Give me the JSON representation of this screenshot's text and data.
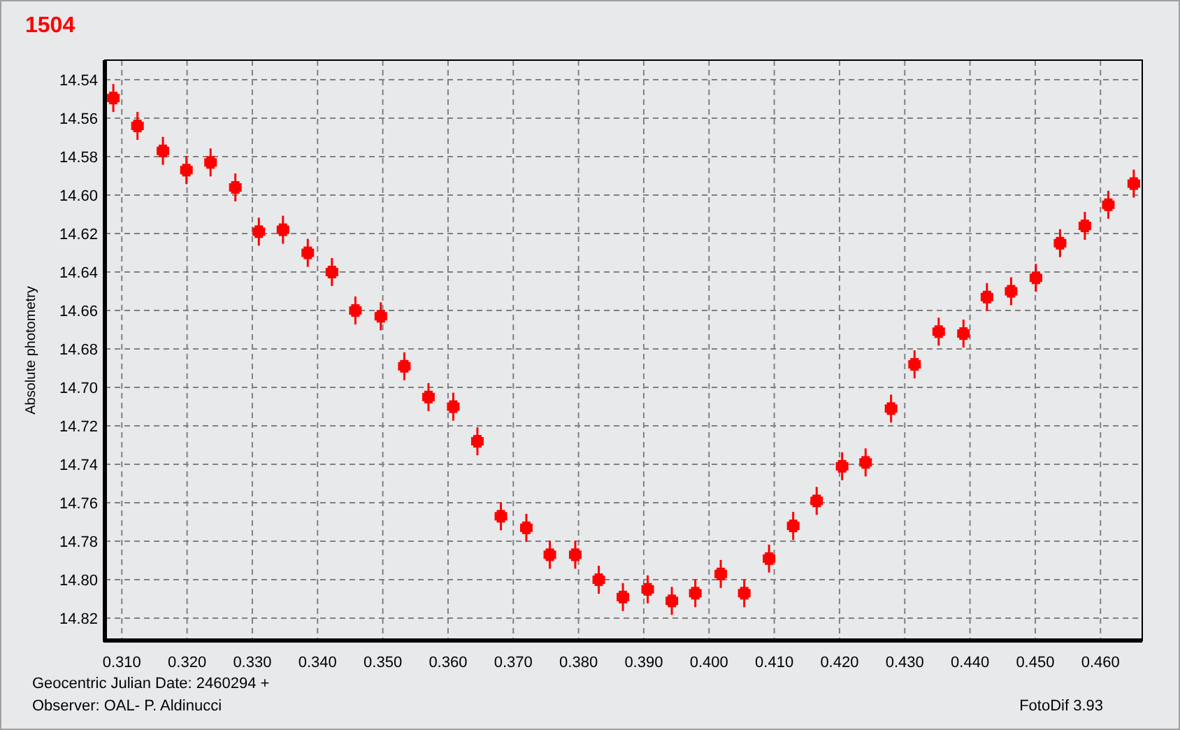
{
  "chart_data": {
    "type": "scatter",
    "grid": true,
    "ylabel": "Absolute photometry",
    "xlim": [
      0.3074,
      0.4664
    ],
    "ylim": [
      14.8316,
      14.5298
    ],
    "xticks": [
      {
        "value": 0.31,
        "label": "0.310"
      },
      {
        "value": 0.32,
        "label": "0.320"
      },
      {
        "value": 0.33,
        "label": "0.330"
      },
      {
        "value": 0.34,
        "label": "0.340"
      },
      {
        "value": 0.35,
        "label": "0.350"
      },
      {
        "value": 0.36,
        "label": "0.360"
      },
      {
        "value": 0.37,
        "label": "0.370"
      },
      {
        "value": 0.38,
        "label": "0.380"
      },
      {
        "value": 0.39,
        "label": "0.390"
      },
      {
        "value": 0.4,
        "label": "0.400"
      },
      {
        "value": 0.41,
        "label": "0.410"
      },
      {
        "value": 0.42,
        "label": "0.420"
      },
      {
        "value": 0.43,
        "label": "0.430"
      },
      {
        "value": 0.44,
        "label": "0.440"
      },
      {
        "value": 0.45,
        "label": "0.450"
      },
      {
        "value": 0.46,
        "label": "0.460"
      }
    ],
    "yticks": [
      {
        "value": 14.54,
        "label": "14.54"
      },
      {
        "value": 14.56,
        "label": "14.56"
      },
      {
        "value": 14.58,
        "label": "14.58"
      },
      {
        "value": 14.6,
        "label": "14.60"
      },
      {
        "value": 14.62,
        "label": "14.62"
      },
      {
        "value": 14.64,
        "label": "14.64"
      },
      {
        "value": 14.66,
        "label": "14.66"
      },
      {
        "value": 14.68,
        "label": "14.68"
      },
      {
        "value": 14.7,
        "label": "14.70"
      },
      {
        "value": 14.72,
        "label": "14.72"
      },
      {
        "value": 14.74,
        "label": "14.74"
      },
      {
        "value": 14.76,
        "label": "14.76"
      },
      {
        "value": 14.78,
        "label": "14.78"
      },
      {
        "value": 14.8,
        "label": "14.80"
      },
      {
        "value": 14.82,
        "label": "14.82"
      }
    ],
    "x": [
      0.3087,
      0.3124,
      0.3163,
      0.3199,
      0.3236,
      0.3274,
      0.331,
      0.3347,
      0.3385,
      0.3422,
      0.3458,
      0.3497,
      0.3533,
      0.357,
      0.3608,
      0.3645,
      0.3681,
      0.372,
      0.3756,
      0.3795,
      0.3831,
      0.3868,
      0.3906,
      0.3943,
      0.3979,
      0.4018,
      0.4054,
      0.4092,
      0.4129,
      0.4165,
      0.4204,
      0.424,
      0.4279,
      0.4315,
      0.4352,
      0.439,
      0.4426,
      0.4463,
      0.4501,
      0.4538,
      0.4576,
      0.4612,
      0.4651
    ],
    "series": [
      {
        "name": "1504",
        "color": "#ff0000",
        "values": [
          14.5495,
          14.564,
          14.577,
          14.587,
          14.583,
          14.596,
          14.619,
          14.618,
          14.63,
          14.64,
          14.66,
          14.663,
          14.689,
          14.705,
          14.71,
          14.728,
          14.767,
          14.773,
          14.787,
          14.787,
          14.8,
          14.809,
          14.805,
          14.811,
          14.807,
          14.797,
          14.807,
          14.789,
          14.772,
          14.759,
          14.741,
          14.739,
          14.711,
          14.688,
          14.671,
          14.672,
          14.653,
          14.65,
          14.643,
          14.625,
          14.616,
          14.605,
          14.594
        ]
      }
    ]
  },
  "xaxis_caption": "Geocentric Julian Date: 2460294 +",
  "observer": "Observer: OAL- P. Aldinucci",
  "software": "FotoDif 3.93"
}
